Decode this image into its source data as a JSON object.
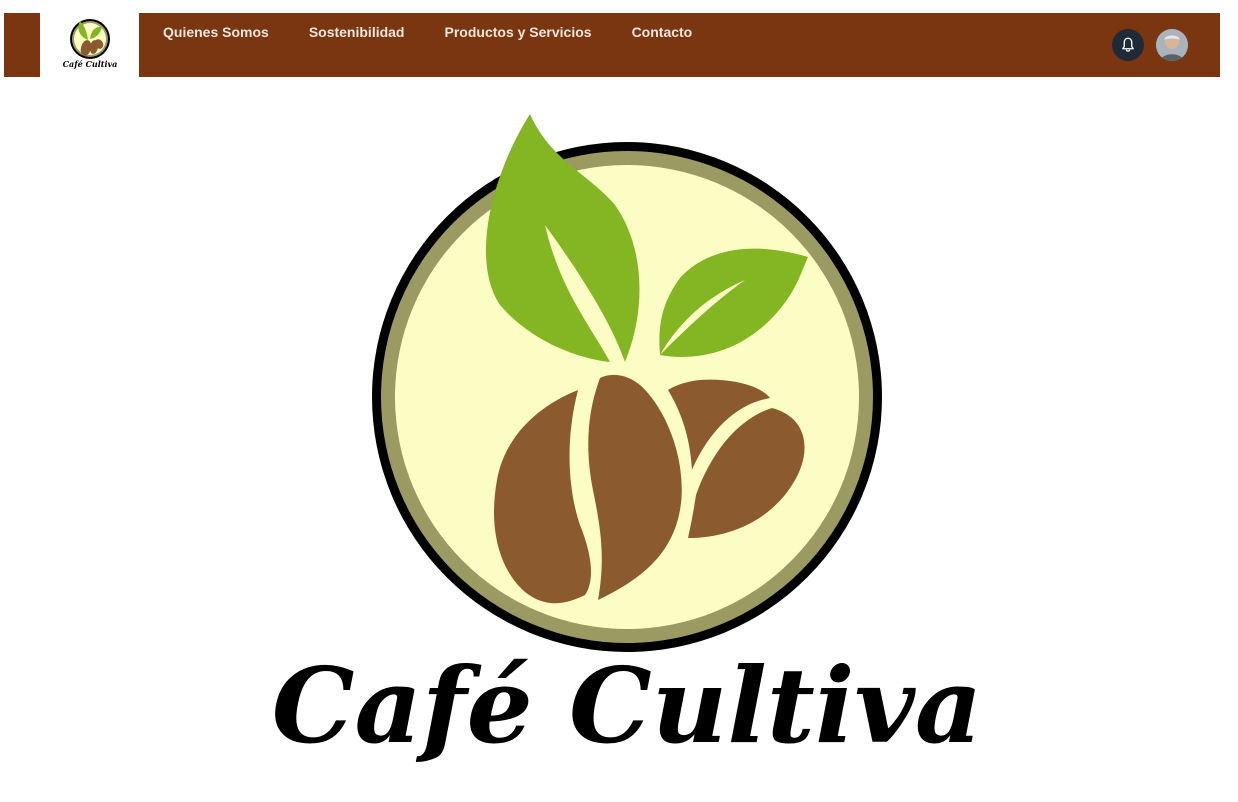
{
  "brand": {
    "name": "Café Cultiva",
    "logo_alt": "cafe-cultiva-logo"
  },
  "nav": {
    "items": [
      {
        "label": "Quienes Somos"
      },
      {
        "label": "Sostenibilidad"
      },
      {
        "label": "Productos y Servicios"
      },
      {
        "label": "Contacto"
      }
    ]
  },
  "icons": {
    "notifications": "bell-icon",
    "user": "avatar"
  },
  "colors": {
    "navbar_bg": "#7a3511",
    "nav_text": "#f3e7dd",
    "leaf_green": "#84b523",
    "bean_brown": "#8b5a2f",
    "circle_fill": "#fcfcc5",
    "ring_olive": "#9a9a62",
    "ring_black": "#000000",
    "bell_bg": "#1f2937"
  }
}
